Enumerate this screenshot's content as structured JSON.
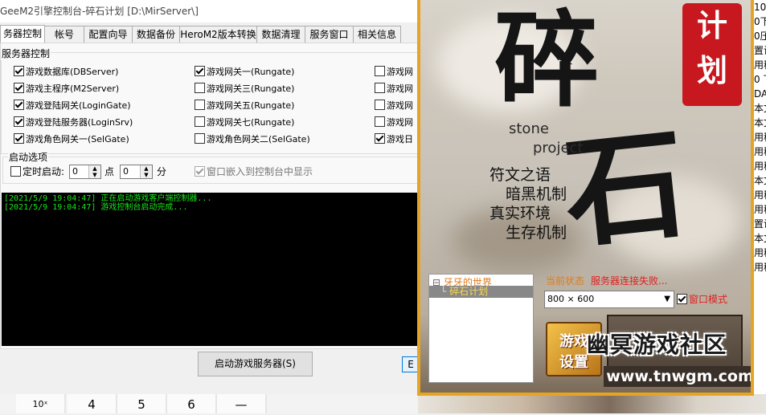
{
  "console": {
    "title": "GeeM2引擎控制台-碎石计划 [D:\\MirServer\\]",
    "tabs": [
      "务器控制",
      "帐号",
      "配置向导",
      "数据备份",
      "HeroM2版本转换",
      "数据清理",
      "服务窗口",
      "相关信息"
    ],
    "active_tab": 0,
    "server_group_title": "服务器控制",
    "checkboxes": [
      {
        "label": "游戏数据库(DBServer)",
        "checked": true
      },
      {
        "label": "游戏主程序(M2Server)",
        "checked": true
      },
      {
        "label": "游戏登陆网关(LoginGate)",
        "checked": true
      },
      {
        "label": "游戏登陆服务器(LoginSrv)",
        "checked": true
      },
      {
        "label": "游戏角色网关一(SelGate)",
        "checked": true
      },
      {
        "label": "游戏网关一(Rungate)",
        "checked": true
      },
      {
        "label": "游戏网关三(Rungate)",
        "checked": false
      },
      {
        "label": "游戏网关五(Rungate)",
        "checked": false
      },
      {
        "label": "游戏网关七(Rungate)",
        "checked": false
      },
      {
        "label": "游戏角色网关二(SelGate)",
        "checked": false
      },
      {
        "label": "游戏网",
        "checked": false
      },
      {
        "label": "游戏网",
        "checked": false
      },
      {
        "label": "游戏网",
        "checked": false
      },
      {
        "label": "游戏网",
        "checked": false
      },
      {
        "label": "游戏日",
        "checked": true
      }
    ],
    "start_options_title": "启动选项",
    "timed_start_label": "定时启动:",
    "timed_start_checked": false,
    "hour_value": "0",
    "hour_unit": "点",
    "minute_value": "0",
    "minute_unit": "分",
    "embed_label": "窗口嵌入到控制台中显示",
    "embed_checked": true,
    "log_lines": [
      "[2021/5/9 19:04:47] 正在启动游戏客户端控制器...",
      "[2021/5/9 19:04:47] 游戏控制台启动完成..."
    ],
    "start_button": "启动游戏服务器(S)",
    "right_button": "E"
  },
  "launcher": {
    "logo_main": "碎",
    "logo_second": "石",
    "logo_badge": [
      "计",
      "划"
    ],
    "stone": "stone",
    "project": "project",
    "poem": [
      "符文之语",
      "暗黑机制",
      "真实环境",
      "生存机制"
    ],
    "tree_root": "牙牙的世界",
    "tree_child": "碎石计划",
    "tree_expander": "⊟",
    "status_label": "当前状态",
    "status_value": "服务器连接失败...",
    "resolution": "800 × 600",
    "window_mode_label": "窗口模式",
    "window_mode_checked": true,
    "settings_line1": "游戏",
    "settings_line2": "设置",
    "watermark_title": "幽冥游戏社区",
    "watermark_url": "www.tnwgm.com"
  },
  "calculator": {
    "keys": [
      "10ˣ",
      "4",
      "5",
      "6",
      "—"
    ]
  },
  "background_window": {
    "lines": [
      "10",
      "0下",
      "0压",
      "置设",
      "用移",
      "0 下",
      "DA",
      "本文",
      "本文",
      "用移",
      "用移",
      "用移",
      "本文",
      "用移",
      "用移",
      "置设",
      "本文",
      "用移",
      "用移"
    ]
  },
  "colors": {
    "launcher_frame": "#e7a423",
    "log_text": "#19e619",
    "status_value": "#e02020",
    "status_label": "#e07b18",
    "badge_red": "#c6181e"
  }
}
